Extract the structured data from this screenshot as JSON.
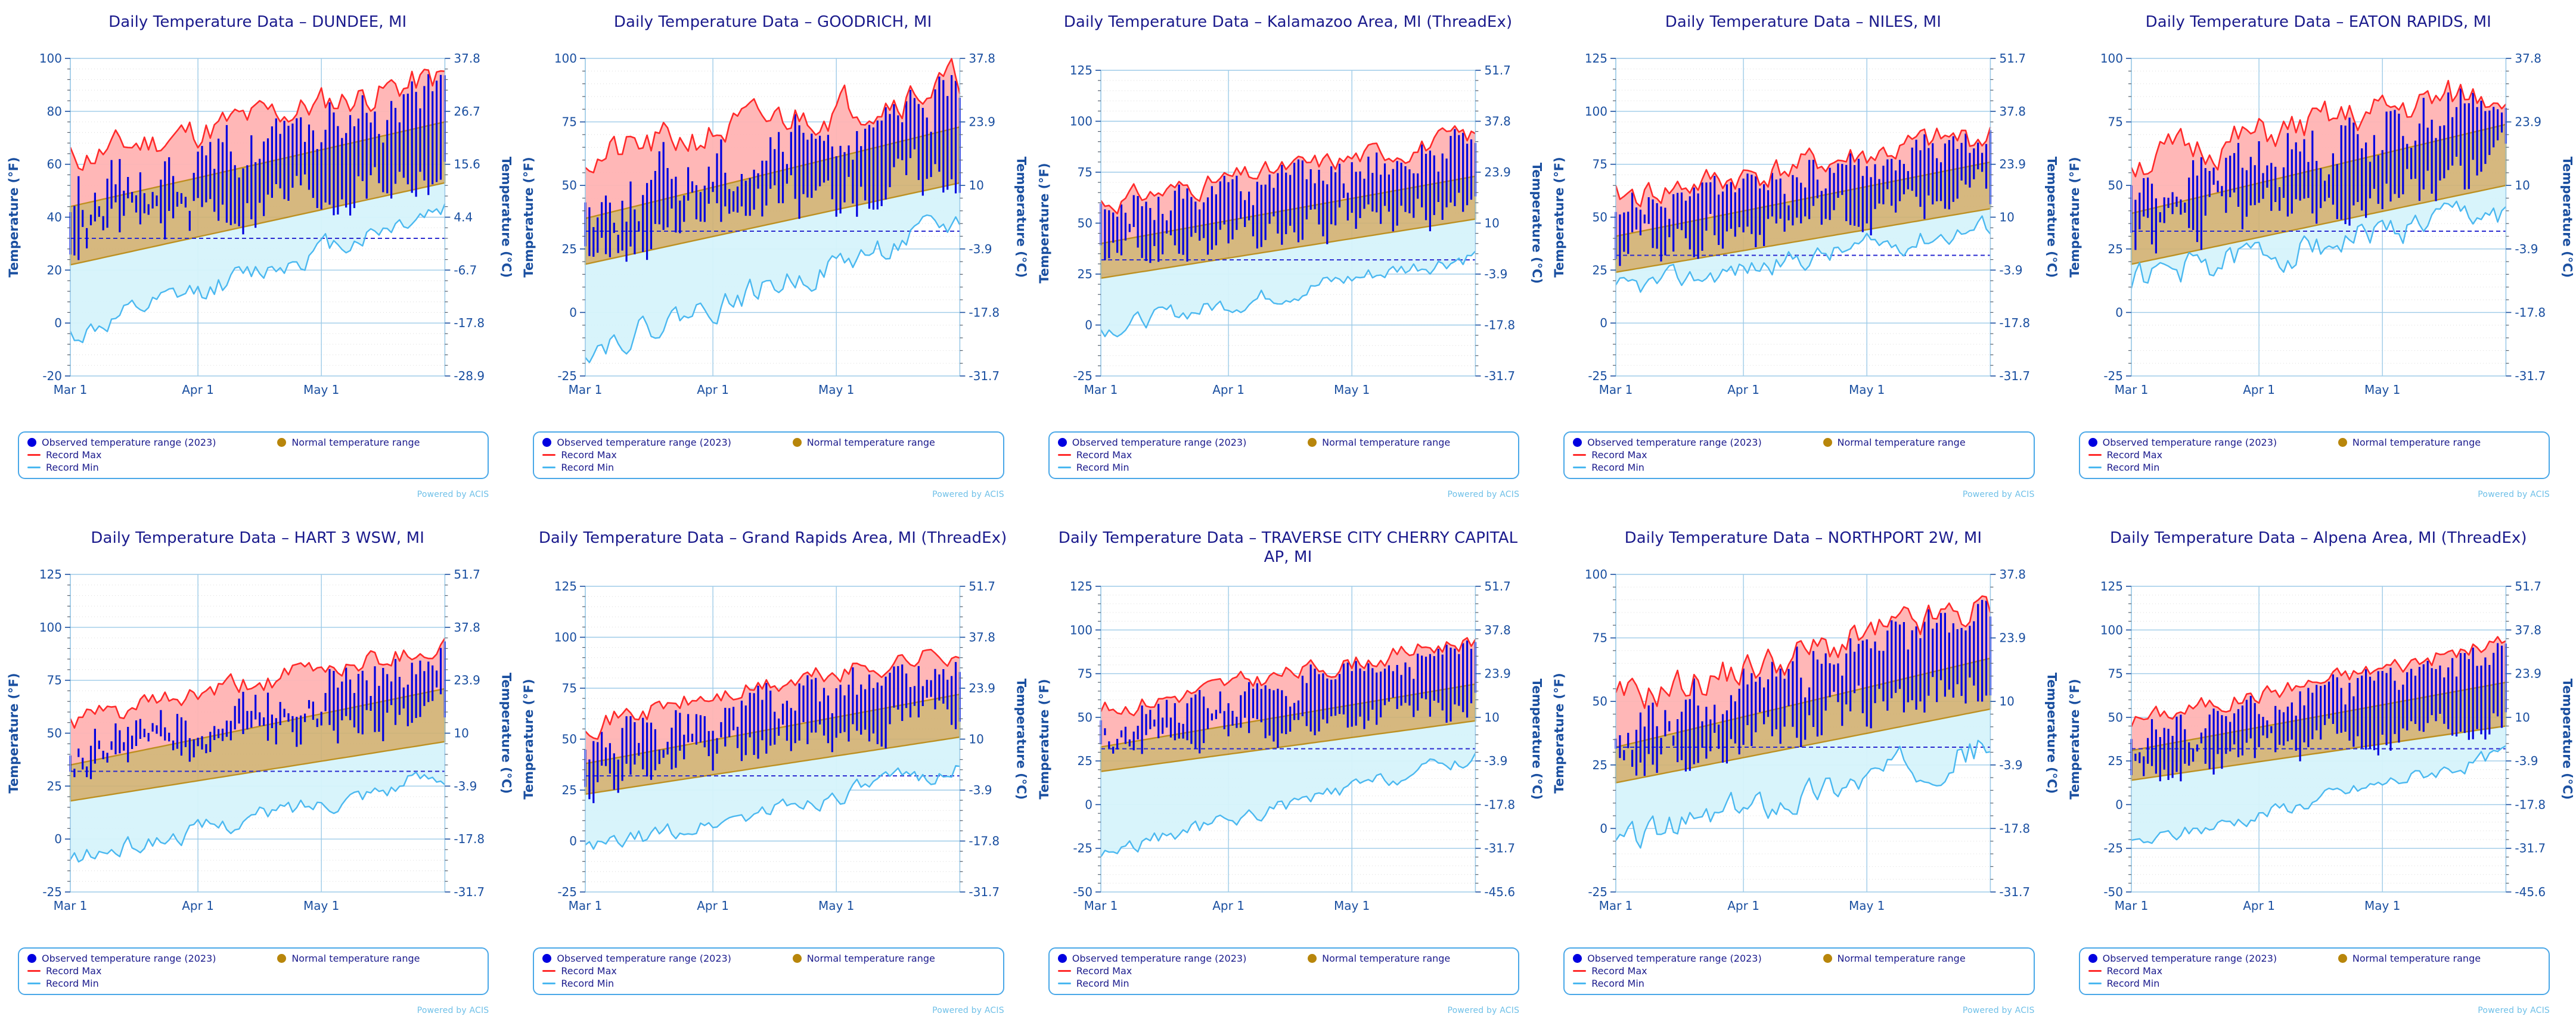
{
  "page": {
    "background": "#ffffff",
    "attribution": "Powered by ACIS",
    "title_prefix": "Daily Temperature Data –"
  },
  "legend": {
    "observed_label": "Observed temperature range (2023)",
    "normal_label": "Normal temperature range",
    "record_max_label": "Record Max",
    "record_min_label": "Record Min",
    "observed_color": "#0000e0",
    "normal_color": "#b8860b",
    "record_max_color": "#ff2a2a",
    "record_min_color": "#4ab8f0",
    "border_color": "#4aa8e8"
  },
  "colors": {
    "title": "#1a1a8c",
    "axis_text": "#1a4fa0",
    "axis_line": "#9ecbe8",
    "record_max_fill": "#ffb3b3",
    "record_min_fill": "#d6f3fb",
    "normal_fill": "#d2b172",
    "normal_edge": "#b8860b",
    "freeze_line": "#2a2ad0"
  },
  "axes": {
    "xlabel": "",
    "ylabel_left": "Temperature (°F)",
    "ylabel_right": "Temperature (°C)",
    "xticks": [
      "Mar 1",
      "Apr 1",
      "May 1"
    ]
  },
  "chart_data": [
    {
      "type": "line",
      "id": "dundee",
      "title": "Daily Temperature Data – DUNDEE, MI",
      "station": "DUNDEE, MI",
      "xlabel": "",
      "ylabel": "Temperature (°F)",
      "ylabel_right": "Temperature (°C)",
      "ylim": [
        -20,
        100
      ],
      "yticks_f": [
        -20,
        0,
        20,
        40,
        60,
        80,
        100
      ],
      "yticks_c": [
        "-28.9",
        "-17.8",
        "-6.7",
        "4.4",
        "15.6",
        "26.7",
        "37.8"
      ],
      "xticks": [
        "Mar 1",
        "Apr 1",
        "May 1"
      ],
      "freeze_line_f": 32,
      "series": [
        {
          "name": "Record Max",
          "start": 62,
          "end": 93,
          "noise": 7,
          "seed": 11
        },
        {
          "name": "Record Min",
          "start": -5,
          "end": 44,
          "noise": 5,
          "seed": 12
        },
        {
          "name": "Normal High",
          "start": 44,
          "end": 76,
          "noise": 0,
          "seed": 13
        },
        {
          "name": "Normal Low",
          "start": 22,
          "end": 53,
          "noise": 0,
          "seed": 14
        },
        {
          "name": "Observed High",
          "start": 47,
          "end": 88,
          "noise": 13,
          "seed": 15
        },
        {
          "name": "Observed Low",
          "start": 33,
          "end": 58,
          "noise": 11,
          "seed": 16
        }
      ]
    },
    {
      "type": "line",
      "id": "goodrich",
      "title": "Daily Temperature Data – GOODRICH, MI",
      "station": "GOODRICH, MI",
      "xlabel": "",
      "ylabel": "Temperature (°F)",
      "ylabel_right": "Temperature (°C)",
      "ylim": [
        -25,
        100
      ],
      "yticks_f": [
        -25,
        0,
        25,
        50,
        75,
        100
      ],
      "yticks_c": [
        "-31.7",
        "-17.8",
        "-3.9",
        "10",
        "23.9",
        "37.8"
      ],
      "xticks": [
        "Mar 1",
        "Apr 1",
        "May 1"
      ],
      "freeze_line_f": 32,
      "series": [
        {
          "name": "Record Max",
          "start": 60,
          "end": 91,
          "noise": 8,
          "seed": 21
        },
        {
          "name": "Record Min",
          "start": -14,
          "end": 35,
          "noise": 6,
          "seed": 22
        },
        {
          "name": "Normal High",
          "start": 37,
          "end": 73,
          "noise": 0,
          "seed": 23
        },
        {
          "name": "Normal Low",
          "start": 19,
          "end": 51,
          "noise": 0,
          "seed": 24
        },
        {
          "name": "Observed High",
          "start": 41,
          "end": 89,
          "noise": 14,
          "seed": 25
        },
        {
          "name": "Observed Low",
          "start": 27,
          "end": 57,
          "noise": 11,
          "seed": 26
        }
      ]
    },
    {
      "type": "line",
      "id": "kalamazoo",
      "title": "Daily Temperature Data – Kalamazoo Area, MI (ThreadEx)",
      "station": "Kalamazoo Area, MI (ThreadEx)",
      "xlabel": "",
      "ylabel": "Temperature (°F)",
      "ylabel_right": "Temperature (°C)",
      "ylim": [
        -25,
        125
      ],
      "yticks_f": [
        -25,
        0,
        25,
        50,
        75,
        100,
        125
      ],
      "yticks_c": [
        "-31.7",
        "-17.8",
        "-3.9",
        "10",
        "23.9",
        "37.8",
        "51.7"
      ],
      "xticks": [
        "Mar 1",
        "Apr 1",
        "May 1"
      ],
      "freeze_line_f": 32,
      "series": [
        {
          "name": "Record Max",
          "start": 60,
          "end": 93,
          "noise": 6,
          "seed": 31
        },
        {
          "name": "Record Min",
          "start": -2,
          "end": 35,
          "noise": 5,
          "seed": 32
        },
        {
          "name": "Normal High",
          "start": 40,
          "end": 73,
          "noise": 0,
          "seed": 33
        },
        {
          "name": "Normal Low",
          "start": 23,
          "end": 52,
          "noise": 0,
          "seed": 34
        },
        {
          "name": "Observed High",
          "start": 59,
          "end": 90,
          "noise": 14,
          "seed": 35
        },
        {
          "name": "Observed Low",
          "start": 34,
          "end": 58,
          "noise": 11,
          "seed": 36
        }
      ]
    },
    {
      "type": "line",
      "id": "niles",
      "title": "Daily Temperature Data – NILES, MI",
      "station": "NILES, MI",
      "xlabel": "",
      "ylabel": "Temperature (°F)",
      "ylabel_right": "Temperature (°C)",
      "ylim": [
        -25,
        125
      ],
      "yticks_f": [
        -25,
        0,
        25,
        50,
        75,
        100,
        125
      ],
      "yticks_c": [
        "-31.7",
        "-17.8",
        "-3.9",
        "10",
        "23.9",
        "37.8",
        "51.7"
      ],
      "xticks": [
        "Mar 1",
        "Apr 1",
        "May 1"
      ],
      "freeze_line_f": 32,
      "series": [
        {
          "name": "Record Max",
          "start": 59,
          "end": 89,
          "noise": 8,
          "seed": 41
        },
        {
          "name": "Record Min",
          "start": 15,
          "end": 46,
          "noise": 6,
          "seed": 42
        },
        {
          "name": "Normal High",
          "start": 41,
          "end": 76,
          "noise": 0,
          "seed": 43
        },
        {
          "name": "Normal Low",
          "start": 24,
          "end": 54,
          "noise": 0,
          "seed": 44
        },
        {
          "name": "Observed High",
          "start": 56,
          "end": 88,
          "noise": 13,
          "seed": 45
        },
        {
          "name": "Observed Low",
          "start": 36,
          "end": 61,
          "noise": 11,
          "seed": 46
        }
      ]
    },
    {
      "type": "line",
      "id": "eaton-rapids",
      "title": "Daily Temperature Data – EATON RAPIDS, MI",
      "station": "EATON RAPIDS, MI",
      "xlabel": "",
      "ylabel": "Temperature (°F)",
      "ylabel_right": "Temperature (°C)",
      "ylim": [
        -25,
        100
      ],
      "yticks_f": [
        -25,
        0,
        25,
        50,
        75,
        100
      ],
      "yticks_c": [
        "-31.7",
        "-17.8",
        "-3.9",
        "10",
        "23.9",
        "37.8"
      ],
      "xticks": [
        "Mar 1",
        "Apr 1",
        "May 1"
      ],
      "freeze_line_f": 32,
      "series": [
        {
          "name": "Record Max",
          "start": 59,
          "end": 88,
          "noise": 8,
          "seed": 51
        },
        {
          "name": "Record Min",
          "start": 13,
          "end": 41,
          "noise": 7,
          "seed": 52
        },
        {
          "name": "Normal High",
          "start": 39,
          "end": 74,
          "noise": 0,
          "seed": 53
        },
        {
          "name": "Normal Low",
          "start": 19,
          "end": 50,
          "noise": 0,
          "seed": 54
        },
        {
          "name": "Observed High",
          "start": 46,
          "end": 88,
          "noise": 14,
          "seed": 55
        },
        {
          "name": "Observed Low",
          "start": 31,
          "end": 58,
          "noise": 11,
          "seed": 56
        }
      ]
    },
    {
      "type": "line",
      "id": "hart-3-wsw",
      "title": "Daily Temperature Data – HART 3 WSW, MI",
      "station": "HART 3 WSW, MI",
      "xlabel": "",
      "ylabel": "Temperature (°F)",
      "ylabel_right": "Temperature (°C)",
      "ylim": [
        -25,
        125
      ],
      "yticks_f": [
        -25,
        0,
        25,
        50,
        75,
        100,
        125
      ],
      "yticks_c": [
        "-31.7",
        "-17.8",
        "-3.9",
        "10",
        "23.9",
        "37.8",
        "51.7"
      ],
      "xticks": [
        "Mar 1",
        "Apr 1",
        "May 1"
      ],
      "freeze_line_f": 32,
      "series": [
        {
          "name": "Record Max",
          "start": 55,
          "end": 92,
          "noise": 6,
          "seed": 61
        },
        {
          "name": "Record Min",
          "start": -10,
          "end": 31,
          "noise": 5,
          "seed": 62
        },
        {
          "name": "Normal High",
          "start": 35,
          "end": 71,
          "noise": 0,
          "seed": 63
        },
        {
          "name": "Normal Low",
          "start": 18,
          "end": 46,
          "noise": 0,
          "seed": 64
        },
        {
          "name": "Observed High",
          "start": 41,
          "end": 88,
          "noise": 13,
          "seed": 65
        },
        {
          "name": "Observed Low",
          "start": 33,
          "end": 62,
          "noise": 11,
          "seed": 66
        }
      ]
    },
    {
      "type": "line",
      "id": "grand-rapids",
      "title": "Daily Temperature Data – Grand Rapids Area, MI (ThreadEx)",
      "station": "Grand Rapids Area, MI (ThreadEx)",
      "xlabel": "",
      "ylabel": "Temperature (°F)",
      "ylabel_right": "Temperature (°C)",
      "ylim": [
        -25,
        125
      ],
      "yticks_f": [
        -25,
        0,
        25,
        50,
        75,
        100,
        125
      ],
      "yticks_c": [
        "-31.7",
        "-17.8",
        "-3.9",
        "10",
        "23.9",
        "37.8",
        "51.7"
      ],
      "xticks": [
        "Mar 1",
        "Apr 1",
        "May 1"
      ],
      "freeze_line_f": 32,
      "series": [
        {
          "name": "Record Max",
          "start": 58,
          "end": 94,
          "noise": 6,
          "seed": 71
        },
        {
          "name": "Record Min",
          "start": -5,
          "end": 36,
          "noise": 5,
          "seed": 72
        },
        {
          "name": "Normal High",
          "start": 38,
          "end": 72,
          "noise": 0,
          "seed": 73
        },
        {
          "name": "Normal Low",
          "start": 23,
          "end": 51,
          "noise": 0,
          "seed": 74
        },
        {
          "name": "Observed High",
          "start": 47,
          "end": 90,
          "noise": 14,
          "seed": 75
        },
        {
          "name": "Observed Low",
          "start": 31,
          "end": 64,
          "noise": 11,
          "seed": 76
        }
      ]
    },
    {
      "type": "line",
      "id": "traverse-city",
      "title": "Daily Temperature Data – TRAVERSE CITY CHERRY CAPITAL AP, MI",
      "station": "TRAVERSE CITY CHERRY CAPITAL AP, MI",
      "xlabel": "",
      "ylabel": "Temperature (°F)",
      "ylabel_right": "Temperature (°C)",
      "ylim": [
        -50,
        125
      ],
      "yticks_f": [
        -50,
        -25,
        0,
        25,
        50,
        75,
        100,
        125
      ],
      "yticks_c": [
        "-45.6",
        "-31.7",
        "-17.8",
        "-3.9",
        "10",
        "23.9",
        "37.8",
        "51.7"
      ],
      "xticks": [
        "Mar 1",
        "Apr 1",
        "May 1"
      ],
      "freeze_line_f": 32,
      "series": [
        {
          "name": "Record Max",
          "start": 54,
          "end": 95,
          "noise": 6,
          "seed": 81
        },
        {
          "name": "Record Min",
          "start": -28,
          "end": 27,
          "noise": 5,
          "seed": 82
        },
        {
          "name": "Normal High",
          "start": 33,
          "end": 69,
          "noise": 0,
          "seed": 83
        },
        {
          "name": "Normal Low",
          "start": 19,
          "end": 48,
          "noise": 0,
          "seed": 84
        },
        {
          "name": "Observed High",
          "start": 43,
          "end": 93,
          "noise": 13,
          "seed": 85
        },
        {
          "name": "Observed Low",
          "start": 33,
          "end": 57,
          "noise": 10,
          "seed": 86
        }
      ]
    },
    {
      "type": "line",
      "id": "northport-2w",
      "title": "Daily Temperature Data – NORTHPORT 2W, MI",
      "station": "NORTHPORT 2W, MI",
      "xlabel": "",
      "ylabel": "Temperature (°F)",
      "ylabel_right": "Temperature (°C)",
      "ylim": [
        -25,
        100
      ],
      "yticks_f": [
        -25,
        0,
        25,
        50,
        75,
        100
      ],
      "yticks_c": [
        "-31.7",
        "-17.8",
        "-3.9",
        "10",
        "23.9",
        "37.8"
      ],
      "xticks": [
        "Mar 1",
        "Apr 1",
        "May 1"
      ],
      "freeze_line_f": 32,
      "series": [
        {
          "name": "Record Max",
          "start": 50,
          "end": 87,
          "noise": 8,
          "seed": 91
        },
        {
          "name": "Record Min",
          "start": -6,
          "end": 33,
          "noise": 7,
          "seed": 92
        },
        {
          "name": "Normal High",
          "start": 32,
          "end": 67,
          "noise": 0,
          "seed": 93
        },
        {
          "name": "Normal Low",
          "start": 18,
          "end": 47,
          "noise": 0,
          "seed": 94
        },
        {
          "name": "Observed High",
          "start": 39,
          "end": 88,
          "noise": 13,
          "seed": 95
        },
        {
          "name": "Observed Low",
          "start": 26,
          "end": 57,
          "noise": 10,
          "seed": 96
        }
      ]
    },
    {
      "type": "line",
      "id": "alpena",
      "title": "Daily Temperature Data – Alpena Area, MI (ThreadEx)",
      "station": "Alpena Area, MI (ThreadEx)",
      "xlabel": "",
      "ylabel": "Temperature (°F)",
      "ylabel_right": "Temperature (°C)",
      "ylim": [
        -50,
        125
      ],
      "yticks_f": [
        -50,
        -25,
        0,
        25,
        50,
        75,
        100,
        125
      ],
      "yticks_c": [
        "-45.6",
        "-31.7",
        "-17.8",
        "-3.9",
        "10",
        "23.9",
        "37.8",
        "51.7"
      ],
      "xticks": [
        "Mar 1",
        "Apr 1",
        "May 1"
      ],
      "freeze_line_f": 32,
      "series": [
        {
          "name": "Record Max",
          "start": 48,
          "end": 93,
          "noise": 6,
          "seed": 101
        },
        {
          "name": "Record Min",
          "start": -24,
          "end": 29,
          "noise": 5,
          "seed": 102
        },
        {
          "name": "Normal High",
          "start": 31,
          "end": 70,
          "noise": 0,
          "seed": 103
        },
        {
          "name": "Normal Low",
          "start": 14,
          "end": 45,
          "noise": 0,
          "seed": 104
        },
        {
          "name": "Observed High",
          "start": 38,
          "end": 90,
          "noise": 14,
          "seed": 105
        },
        {
          "name": "Observed Low",
          "start": 20,
          "end": 52,
          "noise": 11,
          "seed": 106
        }
      ]
    }
  ]
}
